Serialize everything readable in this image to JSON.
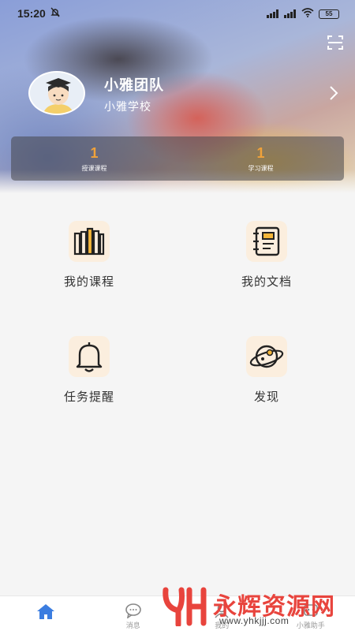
{
  "status_bar": {
    "time": "15:20",
    "notification_icon": "bell-off-icon",
    "battery": "55"
  },
  "header": {
    "scan_icon": "scan-icon",
    "team_name": "小雅团队",
    "school_name": "小雅学校",
    "chevron_icon": "chevron-right-icon",
    "stats": [
      {
        "value": "1",
        "label": "授课课程"
      },
      {
        "value": "1",
        "label": "学习课程"
      }
    ]
  },
  "menu": [
    {
      "label": "我的课程",
      "icon": "books-icon"
    },
    {
      "label": "我的文档",
      "icon": "notebook-icon"
    },
    {
      "label": "任务提醒",
      "icon": "bell-icon"
    },
    {
      "label": "发现",
      "icon": "planet-icon"
    }
  ],
  "tabs": [
    {
      "label": "",
      "icon": "home-icon"
    },
    {
      "label": "消息",
      "icon": "chat-icon"
    },
    {
      "label": "我的",
      "icon": "user-icon"
    },
    {
      "label": "小雅助手",
      "icon": "assistant-icon"
    }
  ],
  "colors": {
    "accent": "#f0a23a",
    "tab_active": "#3b7de0",
    "icon_bg": "#fbeede",
    "watermark": "#e8443d"
  },
  "watermark": {
    "title": "永辉资源网",
    "url": "www.yhkjjj.com"
  }
}
